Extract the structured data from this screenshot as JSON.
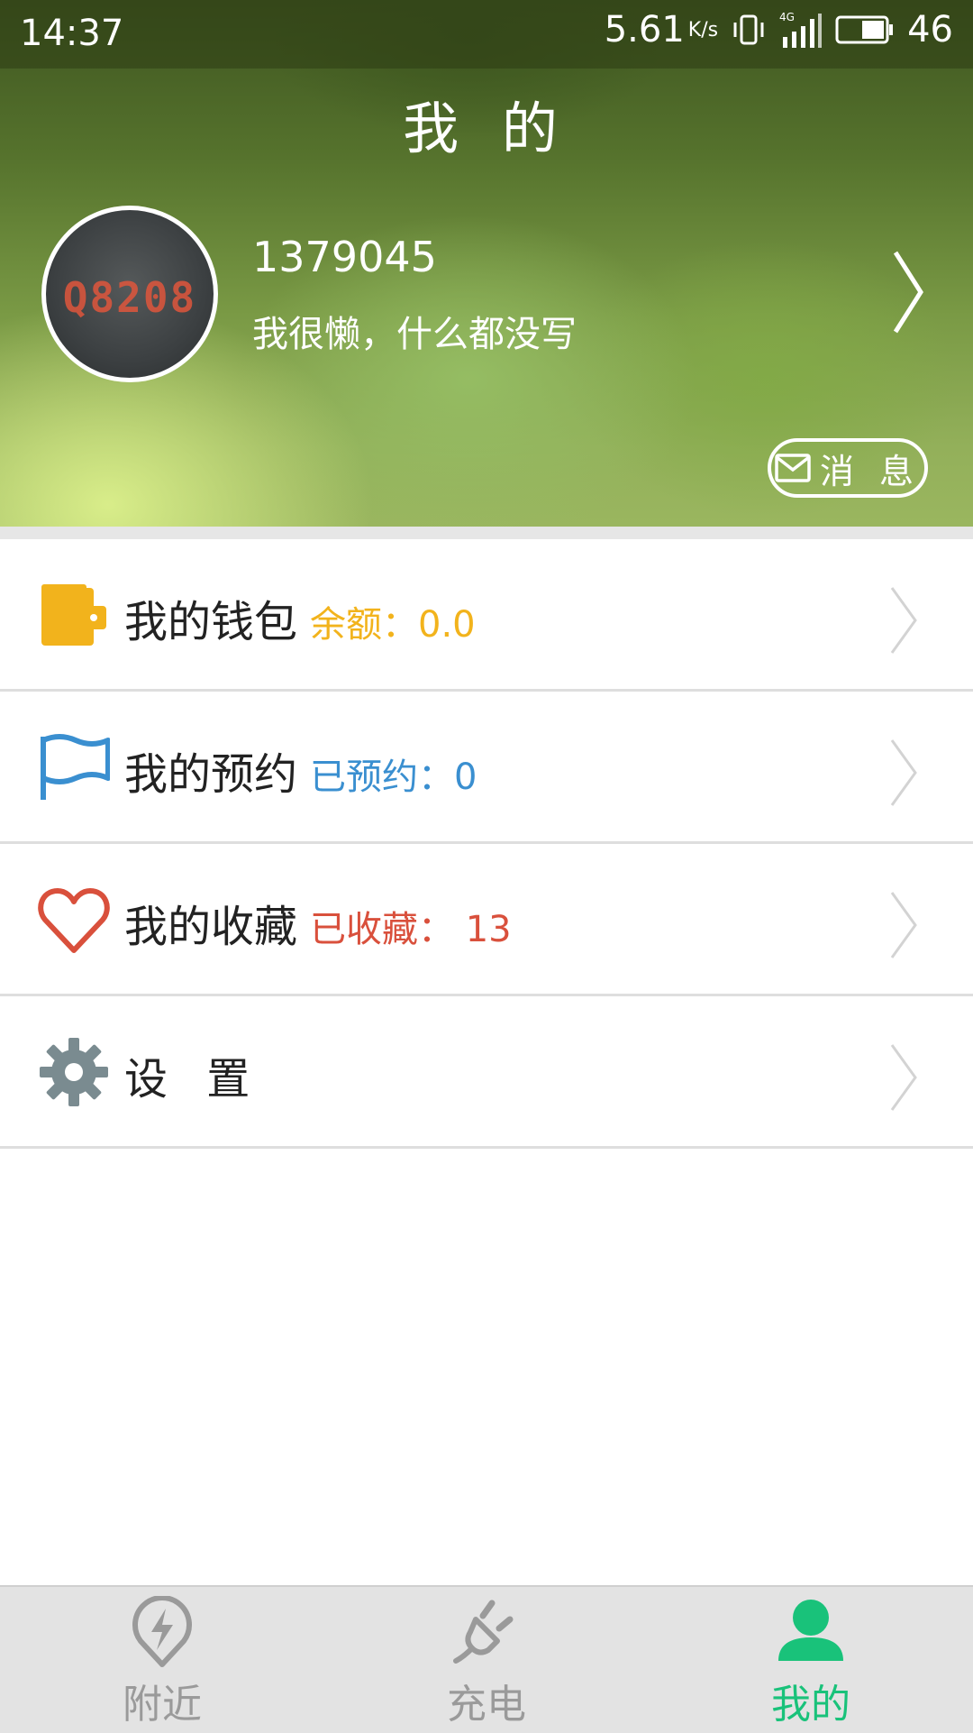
{
  "status_bar": {
    "time": "14:37",
    "net_speed": "5.61",
    "net_unit": "K/s",
    "battery_level": "46",
    "icons": [
      "vibrate-icon",
      "signal-4g-icon",
      "battery-icon"
    ]
  },
  "header": {
    "title": "我 的"
  },
  "profile": {
    "avatar_text": "Q8208",
    "user_id": "1379045",
    "signature": "我很懒，什么都没写",
    "message_label": "消 息"
  },
  "menu": {
    "items": [
      {
        "label": "我的钱包",
        "info": "余额：0.0",
        "icon": "wallet-icon",
        "color": "#f2b31c"
      },
      {
        "label": "我的预约",
        "info": "已预约：0",
        "icon": "flag-icon",
        "color": "#3a8fd0"
      },
      {
        "label": "我的收藏",
        "info": "已收藏： 13",
        "icon": "heart-icon",
        "color": "#d9503c"
      },
      {
        "label": "设 置",
        "info": "",
        "icon": "gear-icon",
        "color": "#7a8b90"
      }
    ]
  },
  "bottom_nav": {
    "tabs": [
      {
        "label": "附近",
        "icon": "location-bolt-icon",
        "active": false
      },
      {
        "label": "充电",
        "icon": "plug-icon",
        "active": false
      },
      {
        "label": "我的",
        "icon": "person-icon",
        "active": true
      }
    ],
    "active_color": "#19c27a",
    "inactive_color": "#9a9a9a"
  }
}
